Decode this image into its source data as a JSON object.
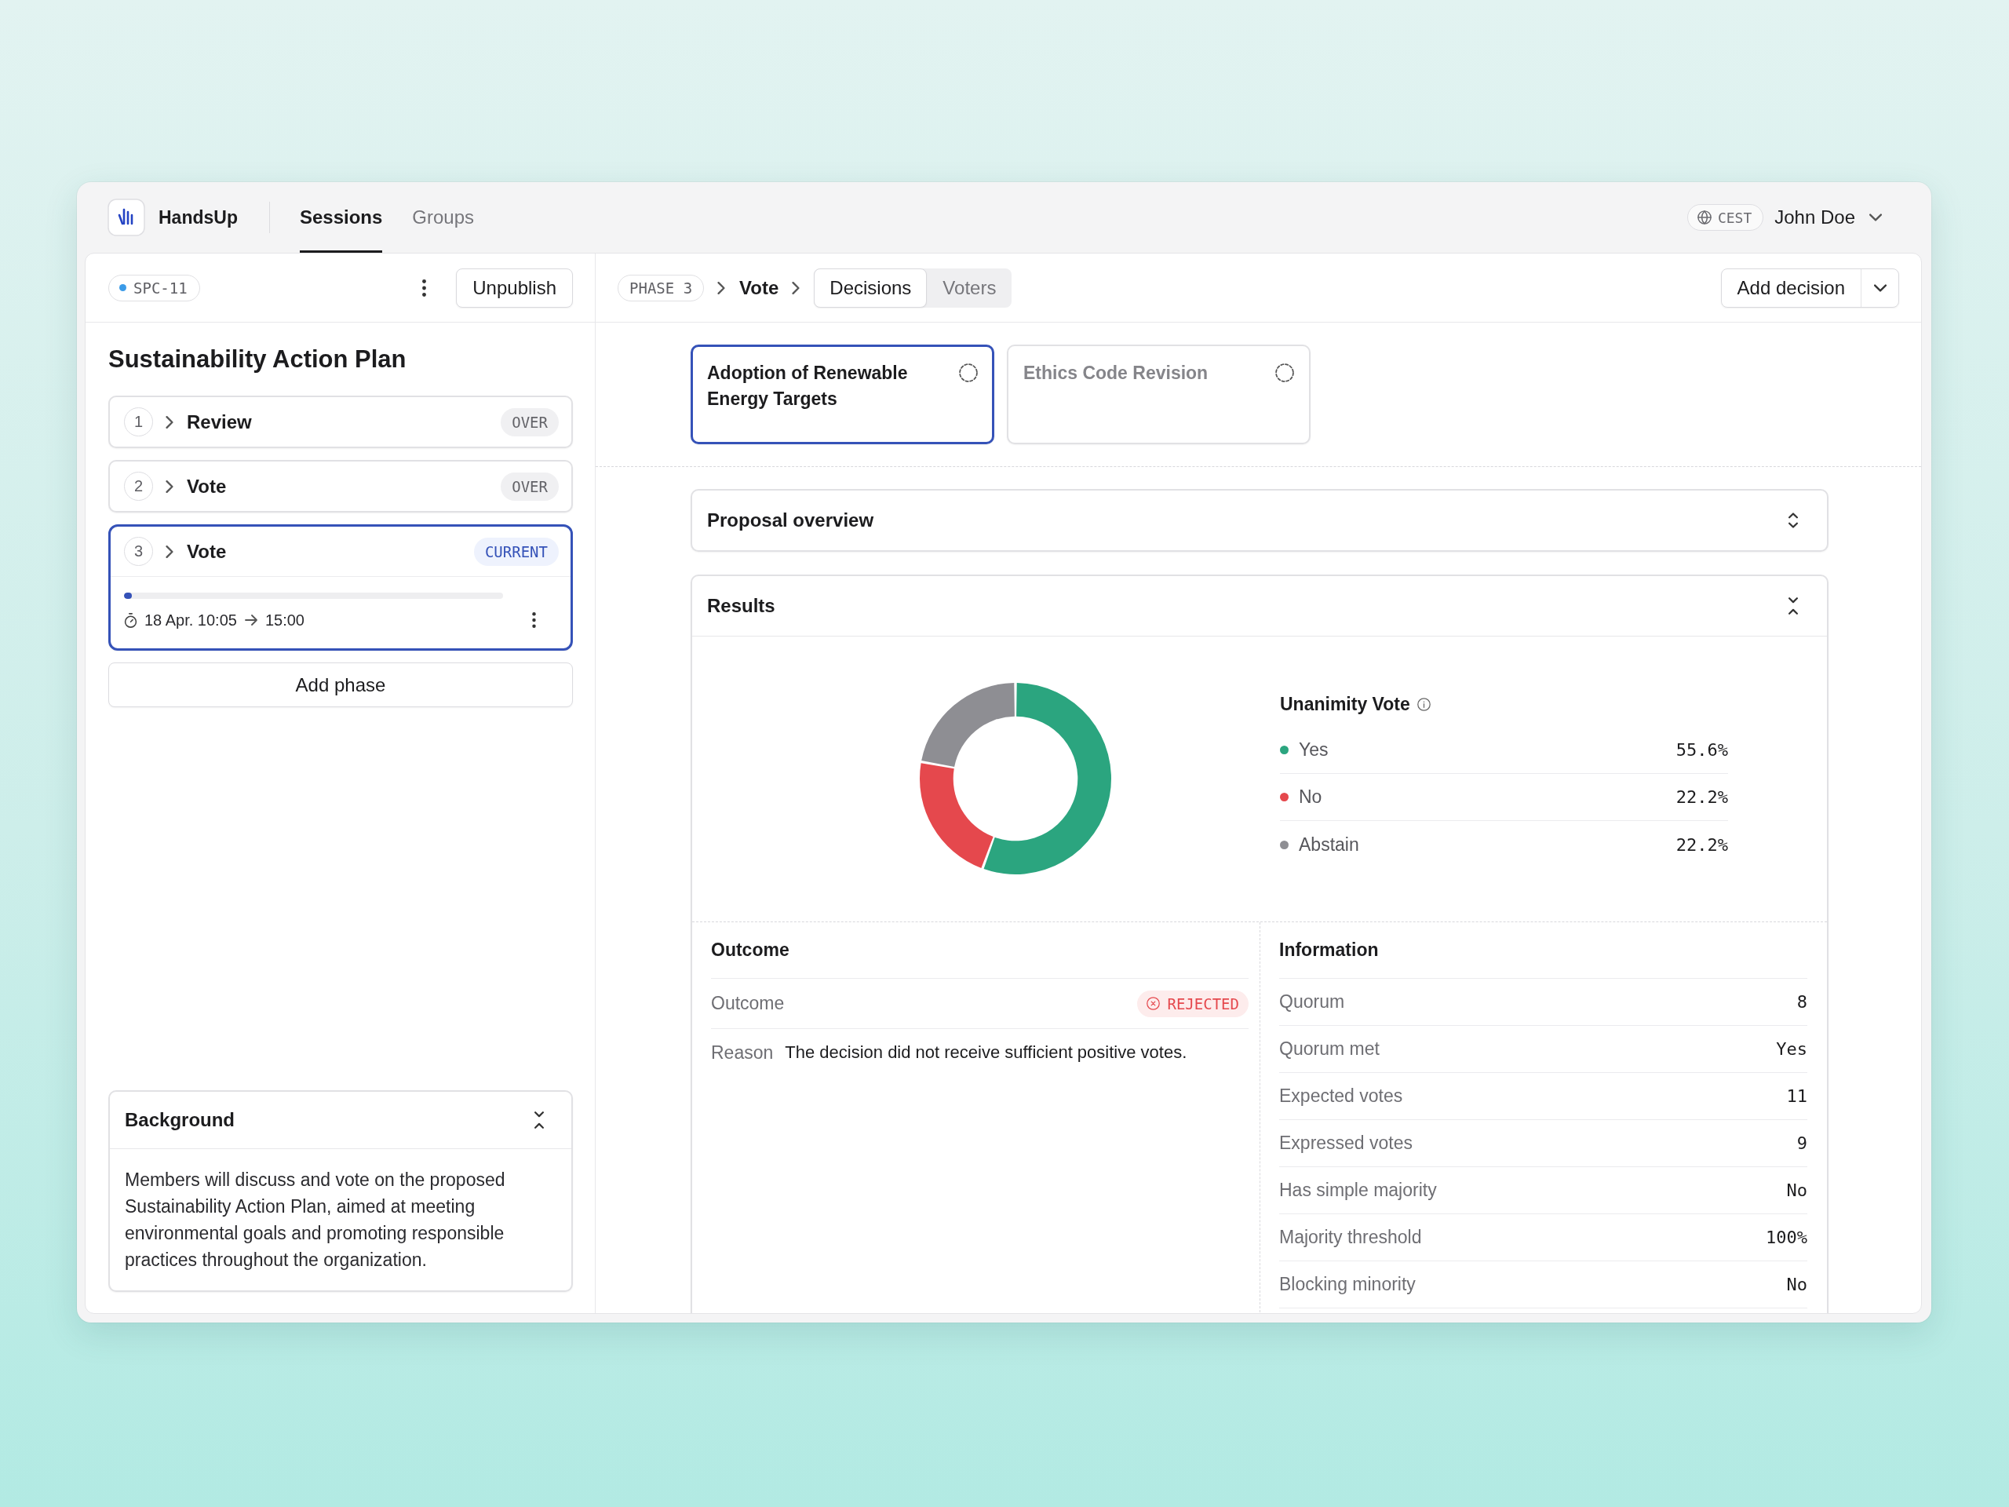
{
  "app": {
    "brand": "HandsUp"
  },
  "nav": {
    "tabs": [
      {
        "label": "Sessions",
        "selected": true
      },
      {
        "label": "Groups",
        "selected": false
      }
    ]
  },
  "user_bar": {
    "timezone": "CEST",
    "user": "John Doe"
  },
  "session": {
    "code": "SPC-11",
    "published": true,
    "publish_button": "Unpublish",
    "title": "Sustainability Action Plan",
    "phases": [
      {
        "number": "1",
        "title": "Review",
        "status": "OVER",
        "current": false,
        "selected": false
      },
      {
        "number": "2",
        "title": "Vote",
        "status": "OVER",
        "current": false,
        "selected": false
      },
      {
        "number": "3",
        "title": "Vote",
        "status": "CURRENT",
        "current": true,
        "selected": true,
        "level": 0.02,
        "start": "18 Apr. 10:05",
        "end": "15:00"
      }
    ],
    "add_phase_button": "Add phase",
    "background": {
      "title": "Background",
      "expanded": true,
      "text": "Members will discuss and vote on the proposed Sustainability Action Plan, aimed at meeting environmental goals and promoting responsible practices throughout the organization."
    }
  },
  "toolbar": {
    "phase": "PHASE 3",
    "step": "Vote",
    "views": [
      {
        "label": "Decisions",
        "selected": true
      },
      {
        "label": "Voters",
        "selected": false
      }
    ],
    "add_button": "Add decision"
  },
  "decisions": [
    {
      "title": "Adoption of Renewable Energy Targets",
      "selected": true
    },
    {
      "title": "Ethics Code Revision",
      "selected": false
    }
  ],
  "proposal_overview": {
    "title": "Proposal overview",
    "expanded": false
  },
  "results": {
    "title": "Results",
    "expanded": true,
    "chart_data": {
      "type": "donut",
      "title": "Unanimity Vote",
      "categories": [
        "Yes",
        "No",
        "Abstain"
      ],
      "values": [
        55.6,
        22.2,
        22.2
      ],
      "value_labels": [
        "55.6%",
        "22.2%",
        "22.2%"
      ],
      "colors": [
        "#2ba57f",
        "#e5484d",
        "#8e8e93"
      ]
    },
    "outcome": {
      "title": "Outcome",
      "rows": [
        {
          "kind": "status",
          "label": "Outcome",
          "value": "REJECTED",
          "negative": true
        },
        {
          "kind": "text",
          "label": "Reason",
          "value": "The decision did not receive sufficient positive votes."
        }
      ]
    },
    "information": {
      "title": "Information",
      "rows": [
        {
          "label": "Quorum",
          "value": "8"
        },
        {
          "label": "Quorum met",
          "value": "Yes"
        },
        {
          "label": "Expected votes",
          "value": "11"
        },
        {
          "label": "Expressed votes",
          "value": "9"
        },
        {
          "label": "Has simple majority",
          "value": "No"
        },
        {
          "label": "Majority threshold",
          "value": "100%"
        },
        {
          "label": "Blocking minority",
          "value": "No"
        }
      ]
    }
  }
}
